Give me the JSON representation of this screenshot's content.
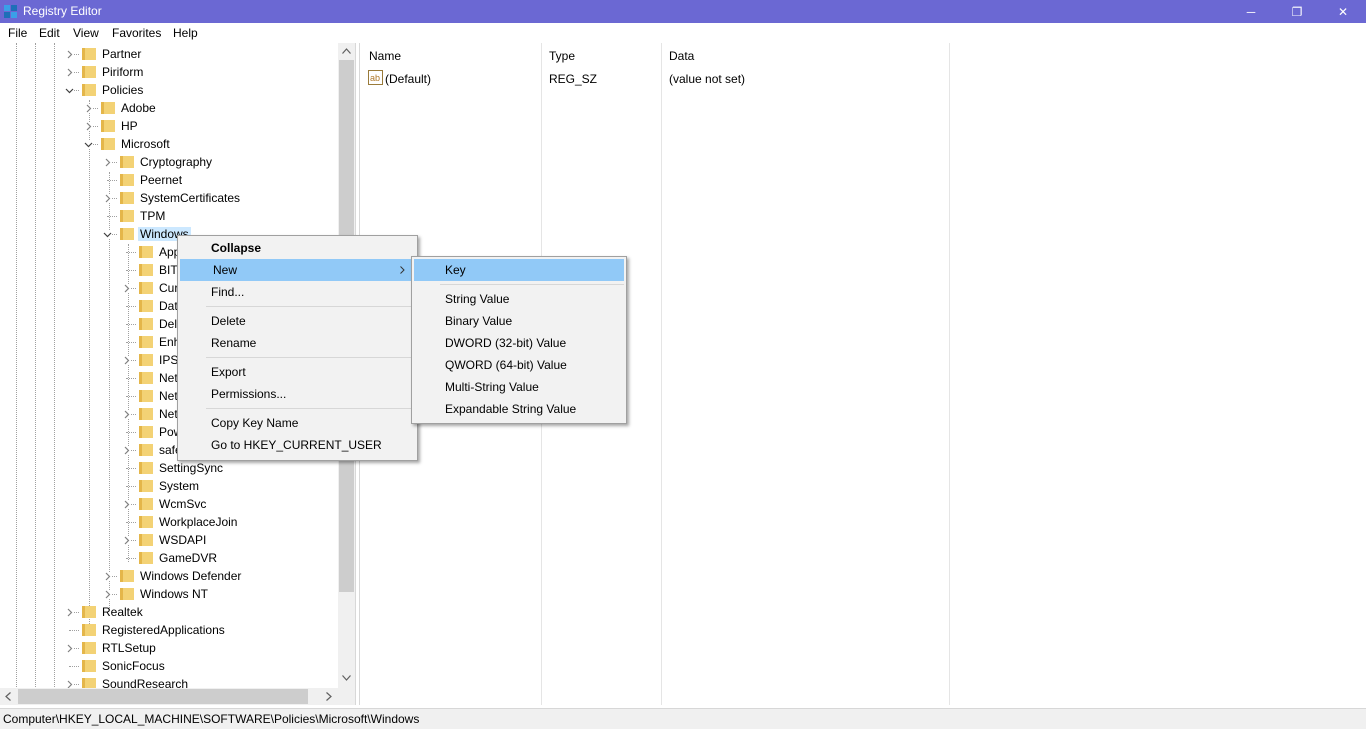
{
  "window": {
    "title": "Registry Editor",
    "minimize": "─",
    "maximize": "❐",
    "close": "✕"
  },
  "menu": [
    "File",
    "Edit",
    "View",
    "Favorites",
    "Help"
  ],
  "tree": [
    {
      "label": "Partner",
      "depth": 0,
      "exp": "collapsed"
    },
    {
      "label": "Piriform",
      "depth": 0,
      "exp": "collapsed"
    },
    {
      "label": "Policies",
      "depth": 0,
      "exp": "expanded"
    },
    {
      "label": "Adobe",
      "depth": 1,
      "exp": "collapsed"
    },
    {
      "label": "HP",
      "depth": 1,
      "exp": "collapsed"
    },
    {
      "label": "Microsoft",
      "depth": 1,
      "exp": "expanded"
    },
    {
      "label": "Cryptography",
      "depth": 2,
      "exp": "collapsed"
    },
    {
      "label": "Peernet",
      "depth": 2,
      "exp": "none"
    },
    {
      "label": "SystemCertificates",
      "depth": 2,
      "exp": "collapsed"
    },
    {
      "label": "TPM",
      "depth": 2,
      "exp": "none"
    },
    {
      "label": "Windows",
      "depth": 2,
      "exp": "expanded",
      "selected": true
    },
    {
      "label": "AppPrivacy",
      "depth": 3,
      "exp": "none"
    },
    {
      "label": "BITS",
      "depth": 3,
      "exp": "none"
    },
    {
      "label": "CurrentVersion",
      "depth": 3,
      "exp": "collapsed"
    },
    {
      "label": "DataCollection",
      "depth": 3,
      "exp": "none"
    },
    {
      "label": "DeliveryOptimization",
      "depth": 3,
      "exp": "none"
    },
    {
      "label": "EnhancedStorageDevices",
      "depth": 3,
      "exp": "none"
    },
    {
      "label": "IPSec",
      "depth": 3,
      "exp": "collapsed"
    },
    {
      "label": "Network Connections",
      "depth": 3,
      "exp": "none"
    },
    {
      "label": "NetworkConnectivityStatusIndicator",
      "depth": 3,
      "exp": "none"
    },
    {
      "label": "NetworkProvider",
      "depth": 3,
      "exp": "collapsed"
    },
    {
      "label": "PowerShell",
      "depth": 3,
      "exp": "none"
    },
    {
      "label": "safer",
      "depth": 3,
      "exp": "collapsed"
    },
    {
      "label": "SettingSync",
      "depth": 3,
      "exp": "none"
    },
    {
      "label": "System",
      "depth": 3,
      "exp": "none"
    },
    {
      "label": "WcmSvc",
      "depth": 3,
      "exp": "collapsed"
    },
    {
      "label": "WorkplaceJoin",
      "depth": 3,
      "exp": "none"
    },
    {
      "label": "WSDAPI",
      "depth": 3,
      "exp": "collapsed"
    },
    {
      "label": "GameDVR",
      "depth": 3,
      "exp": "none"
    },
    {
      "label": "Windows Defender",
      "depth": 2,
      "exp": "collapsed"
    },
    {
      "label": "Windows NT",
      "depth": 2,
      "exp": "collapsed"
    },
    {
      "label": "Realtek",
      "depth": 0,
      "exp": "collapsed"
    },
    {
      "label": "RegisteredApplications",
      "depth": 0,
      "exp": "none"
    },
    {
      "label": "RTLSetup",
      "depth": 0,
      "exp": "collapsed"
    },
    {
      "label": "SonicFocus",
      "depth": 0,
      "exp": "none"
    },
    {
      "label": "SoundResearch",
      "depth": 0,
      "exp": "collapsed"
    }
  ],
  "list": {
    "columns": [
      "Name",
      "Type",
      "Data"
    ],
    "rows": [
      {
        "name": "(Default)",
        "type": "REG_SZ",
        "data": "(value not set)"
      }
    ]
  },
  "context_menu": {
    "items": [
      {
        "label": "Collapse",
        "bold": true
      },
      {
        "label": "New",
        "submenu": true,
        "highlighted": true
      },
      {
        "label": "Find..."
      },
      {
        "divider": true
      },
      {
        "label": "Delete"
      },
      {
        "label": "Rename"
      },
      {
        "divider": true
      },
      {
        "label": "Export"
      },
      {
        "label": "Permissions..."
      },
      {
        "divider": true
      },
      {
        "label": "Copy Key Name"
      },
      {
        "label": "Go to HKEY_CURRENT_USER"
      }
    ]
  },
  "submenu": {
    "items": [
      {
        "label": "Key",
        "highlighted": true
      },
      {
        "divider": true
      },
      {
        "label": "String Value"
      },
      {
        "label": "Binary Value"
      },
      {
        "label": "DWORD (32-bit) Value"
      },
      {
        "label": "QWORD (64-bit) Value"
      },
      {
        "label": "Multi-String Value"
      },
      {
        "label": "Expandable String Value"
      }
    ]
  },
  "status": "Computer\\HKEY_LOCAL_MACHINE\\SOFTWARE\\Policies\\Microsoft\\Windows",
  "colors": {
    "titlebar": "#6b68d3",
    "highlight": "#91c9f7",
    "folder": "#f3d275",
    "selection": "#cce8ff"
  }
}
